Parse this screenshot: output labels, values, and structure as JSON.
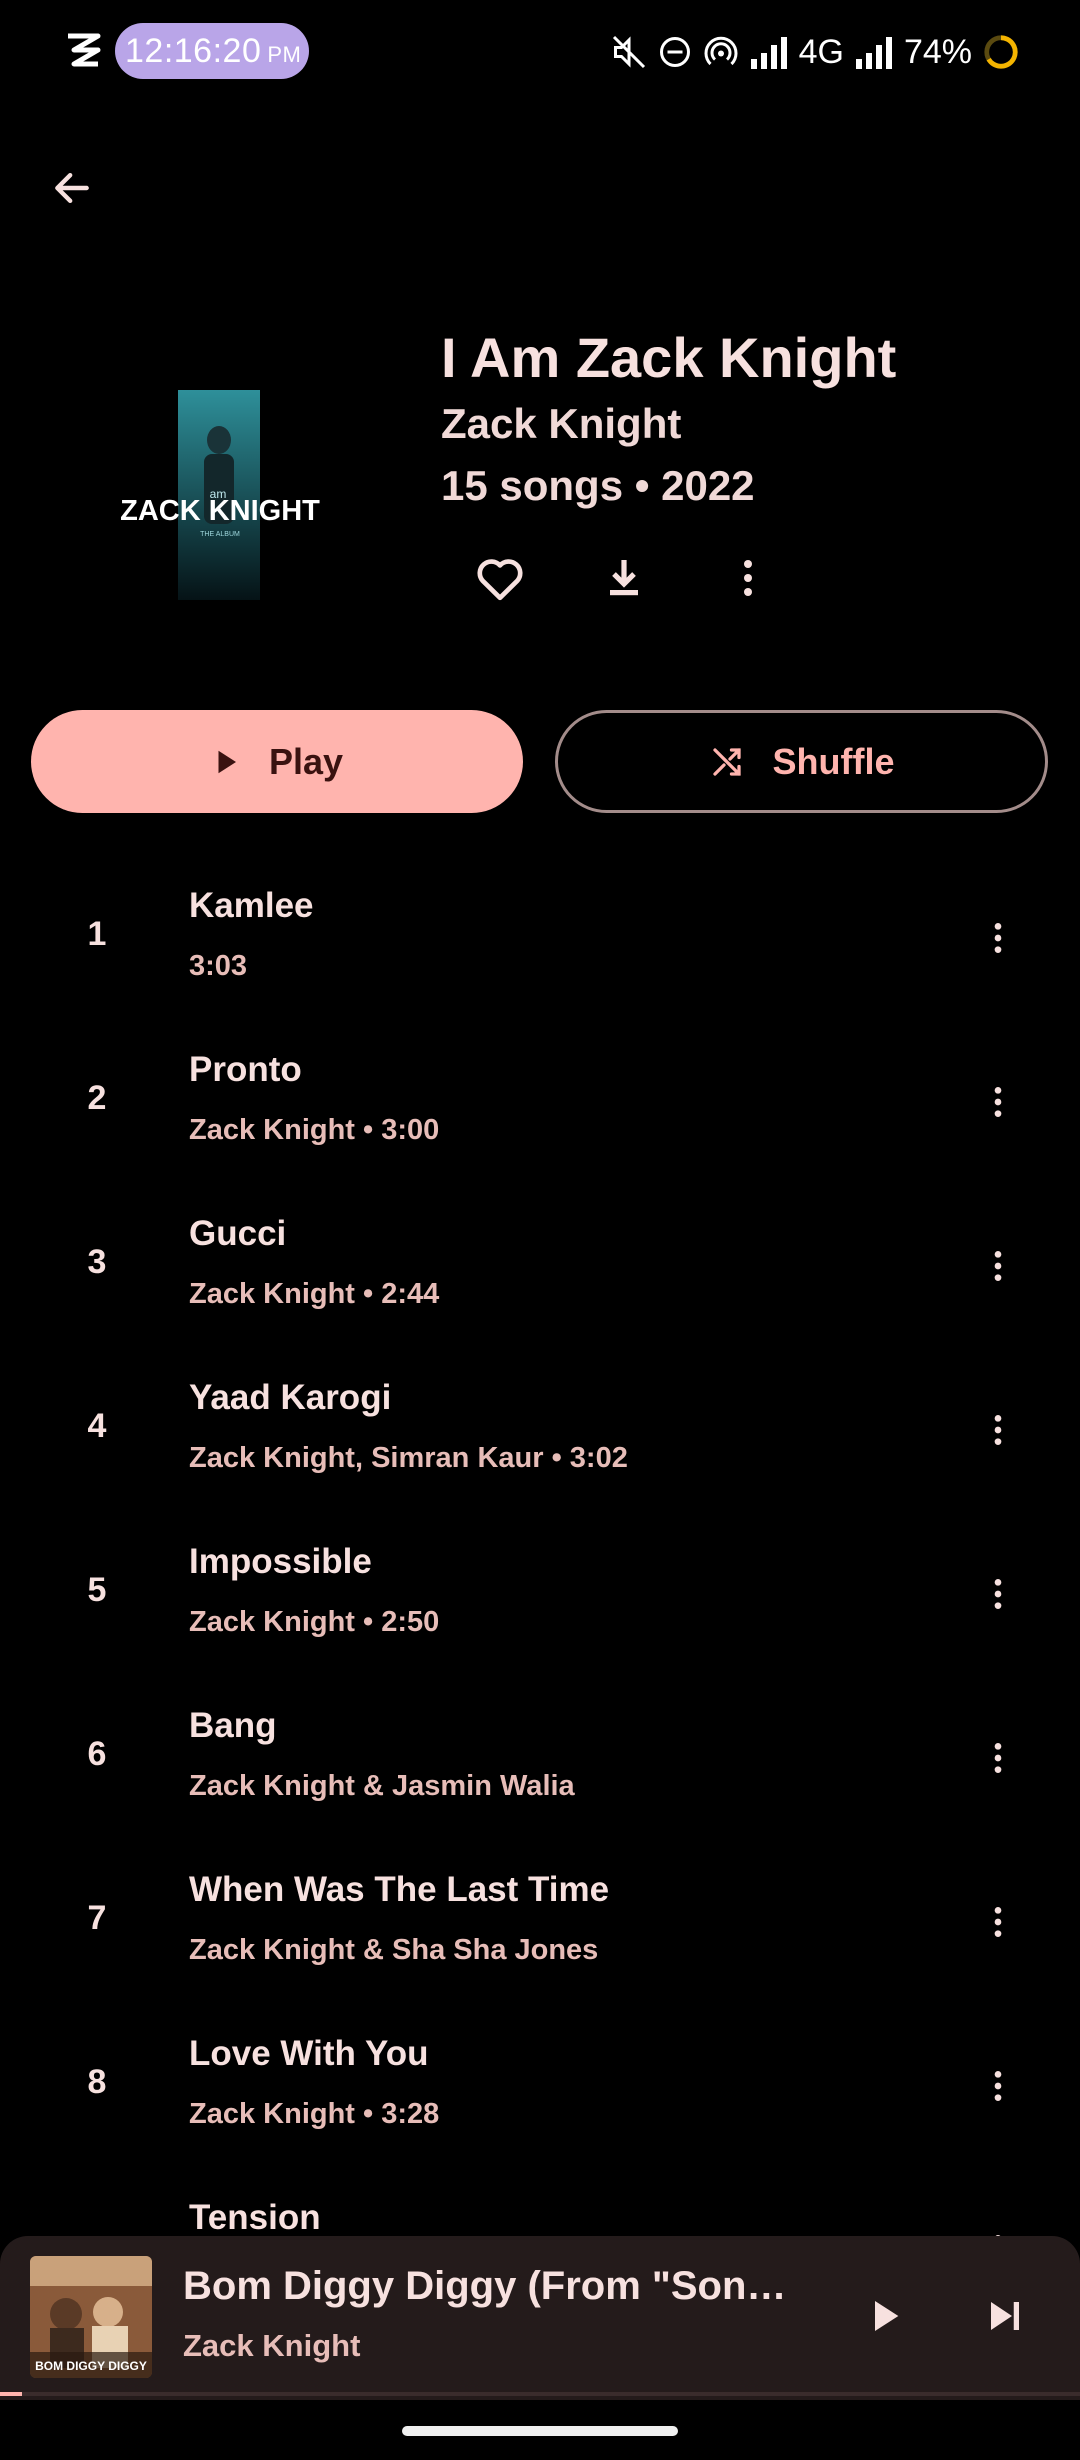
{
  "status_bar": {
    "time": "12:16:20",
    "ampm": "PM",
    "network": "4G",
    "battery": "74%",
    "icons": [
      "app-logo-icon",
      "mute-icon",
      "dnd-icon",
      "hotspot-icon",
      "signal-icon",
      "signal-icon-2",
      "battery-saver-icon"
    ]
  },
  "header": {
    "back_icon": "arrow-back-icon"
  },
  "album": {
    "title": "I Am Zack Knight",
    "artist": "Zack Knight",
    "meta": "15 songs • 2022",
    "art_text": "ZACK KNIGHT",
    "art_small": "THE ALBUM",
    "actions": [
      "heart-icon",
      "download-icon",
      "more-vert-icon"
    ]
  },
  "buttons": {
    "play_label": "Play",
    "shuffle_label": "Shuffle"
  },
  "tracks": [
    {
      "num": "1",
      "title": "Kamlee",
      "sub": "3:03"
    },
    {
      "num": "2",
      "title": "Pronto",
      "sub": "Zack Knight • 3:00"
    },
    {
      "num": "3",
      "title": "Gucci",
      "sub": "Zack Knight • 2:44"
    },
    {
      "num": "4",
      "title": "Yaad Karogi",
      "sub": "Zack Knight, Simran Kaur • 3:02"
    },
    {
      "num": "5",
      "title": "Impossible",
      "sub": "Zack Knight • 2:50"
    },
    {
      "num": "6",
      "title": "Bang",
      "sub": "Zack Knight & Jasmin Walia"
    },
    {
      "num": "7",
      "title": "When Was The Last Time",
      "sub": "Zack Knight & Sha Sha Jones"
    },
    {
      "num": "8",
      "title": "Love With You",
      "sub": "Zack Knight • 3:28"
    },
    {
      "num": "",
      "title": "Tension",
      "sub": ""
    }
  ],
  "mini_player": {
    "title": "Bom Diggy Diggy (From \"Son…",
    "artist": "Zack Knight",
    "art_text": "BOM DIGGY DIGGY",
    "progress": 0.02
  },
  "colors": {
    "accent": "#ffb4ae",
    "background": "#000000",
    "text": "#f7e1df",
    "subtext": "#e7bdb8",
    "mini_player_bg": "#241b1b"
  }
}
